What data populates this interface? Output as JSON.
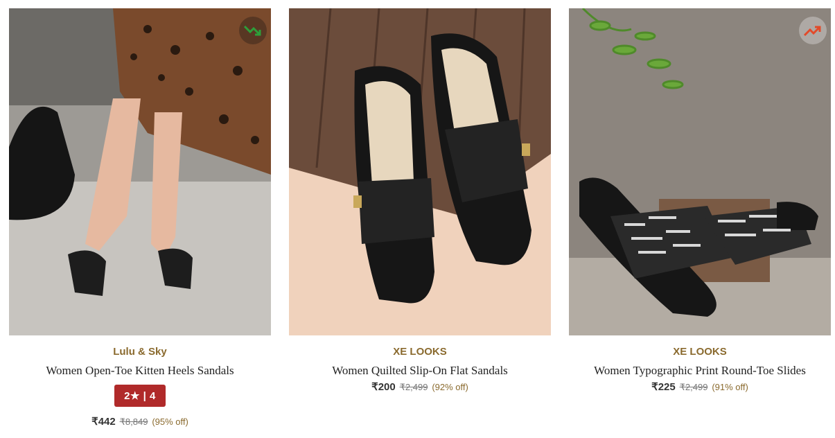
{
  "products": [
    {
      "brand": "Lulu & Sky",
      "title": "Women Open-Toe Kitten Heels Sandals",
      "rating": "2★ | 4",
      "price": "₹442",
      "mrp": "₹8,849",
      "discount": "(95% off)",
      "trend": "trending-down-icon",
      "trend_color": "#2e9e3a"
    },
    {
      "brand": "XE LOOKS",
      "title": "Women Quilted Slip-On Flat Sandals",
      "price": "₹200",
      "mrp": "₹2,499",
      "discount": "(92% off)"
    },
    {
      "brand": "XE LOOKS",
      "title": "Women Typographic Print Round-Toe Slides",
      "price": "₹225",
      "mrp": "₹2,499",
      "discount": "(91% off)",
      "trend": "trending-up-icon",
      "trend_color": "#e24a2a"
    }
  ],
  "colors": {
    "brand": "#8a6a2e",
    "rating_bg": "#b02a2a"
  }
}
